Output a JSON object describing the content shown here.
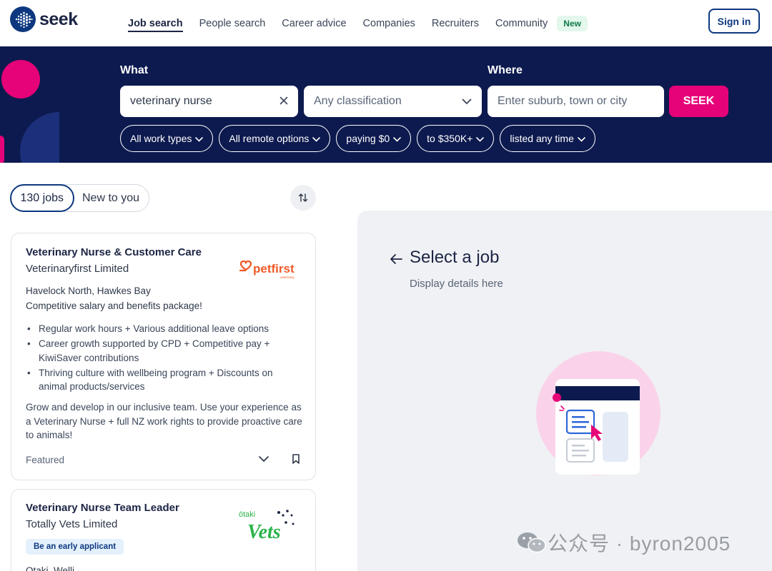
{
  "brand": {
    "name": "seek"
  },
  "nav": {
    "items": [
      {
        "label": "Job search",
        "active": true
      },
      {
        "label": "People search",
        "active": false
      },
      {
        "label": "Career advice",
        "active": false
      },
      {
        "label": "Companies",
        "active": false
      },
      {
        "label": "Recruiters",
        "active": false
      },
      {
        "label": "Community",
        "active": false
      }
    ],
    "new_badge": "New",
    "signin_label": "Sign in"
  },
  "search": {
    "what_label": "What",
    "what_value": "veterinary nurse",
    "classification_placeholder": "Any classification",
    "where_label": "Where",
    "where_placeholder": "Enter suburb, town or city",
    "submit_label": "SEEK",
    "filters": [
      "All work types",
      "All remote options",
      "paying $0",
      "to $350K+",
      "listed any time"
    ]
  },
  "results": {
    "count_label": "130 jobs",
    "new_label": "New to you"
  },
  "jobs": [
    {
      "title": "Veterinary Nurse & Customer Care",
      "company": "Veterinaryfirst Limited",
      "location": "Havelock North, Hawkes Bay",
      "salary": "Competitive salary and benefits package!",
      "bullets": [
        "Regular work hours + Various additional leave options",
        "Career growth supported by CPD + Competitive pay + KiwiSaver contributions",
        "Thriving culture with wellbeing program + Discounts on animal products/services"
      ],
      "description": "Grow and develop in our inclusive team. Use your experience as a Veterinary Nurse + full NZ work rights to provide proactive care to animals!",
      "featured_label": "Featured",
      "logo_text": "petfirst",
      "logo_sub": "veterinary"
    },
    {
      "title": "Veterinary Nurse Team Leader",
      "company": "Totally Vets Limited",
      "badge": "Be an early applicant",
      "location_partial": "Otaki, Welli...",
      "logo_top": "ōtaki",
      "logo_text": "Vets"
    }
  ],
  "detail": {
    "title": "Select a job",
    "subtitle": "Display details here"
  },
  "watermark": "公众号 · byron2005",
  "colors": {
    "navy": "#0d1a4f",
    "brand_blue": "#0d3880",
    "pink": "#e60278",
    "logo_orange": "#f05a28",
    "vets_green": "#2bb34a"
  }
}
